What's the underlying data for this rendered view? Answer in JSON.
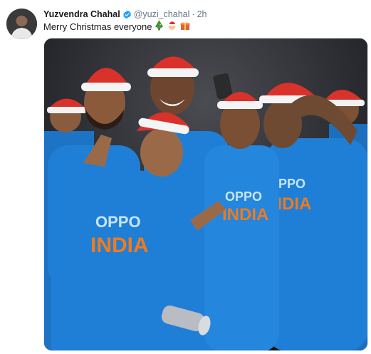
{
  "tweet": {
    "author_name": "Yuzvendra Chahal",
    "handle": "@yuzi_chahal",
    "separator": "·",
    "time": "2h",
    "text": "Merry Christmas everyone",
    "emojis": [
      "christmas-tree-icon",
      "santa-icon",
      "gift-icon"
    ]
  },
  "media": {
    "jersey_sponsor": "OPPO",
    "jersey_text": "INDIA",
    "colors": {
      "jersey_blue": "#1f7fd6",
      "jersey_orange": "#f07a1d",
      "hat_red": "#d8322b",
      "background": "#1b1d22",
      "verified_blue": "#1da1f2"
    }
  }
}
